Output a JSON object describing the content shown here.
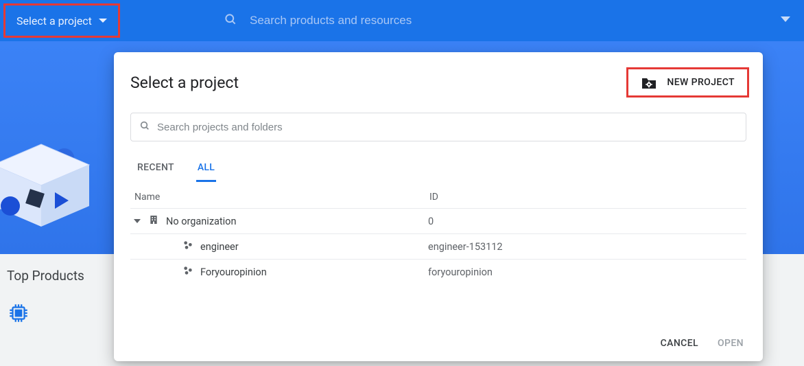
{
  "topbar": {
    "project_dropdown_label": "Select a project",
    "search_placeholder": "Search products and resources"
  },
  "below_content": {
    "heading": "Top Products"
  },
  "modal": {
    "title": "Select a project",
    "new_project_label": "New Project",
    "search_placeholder": "Search projects and folders",
    "tabs": {
      "recent": "Recent",
      "all": "All"
    },
    "columns": {
      "name": "Name",
      "id": "ID"
    },
    "rows": [
      {
        "type": "org",
        "name": "No organization",
        "id": "0",
        "expanded": true,
        "indent": 0
      },
      {
        "type": "project",
        "name": "engineer",
        "id": "engineer-153112",
        "indent": 1
      },
      {
        "type": "project",
        "name": "Foryouropinion",
        "id": "foryouropinion",
        "indent": 1
      }
    ],
    "footer": {
      "cancel": "Cancel",
      "open": "Open"
    }
  },
  "highlight_color": "#e53935",
  "accent_color": "#1a73e8"
}
